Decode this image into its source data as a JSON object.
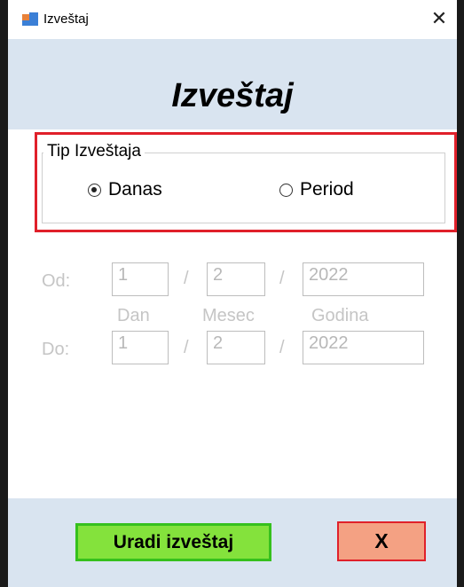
{
  "window": {
    "title": "Izveštaj",
    "close_label": "✕"
  },
  "header": {
    "title": "Izveštaj"
  },
  "report_type": {
    "legend": "Tip Izveštaja",
    "options": [
      {
        "label": "Danas",
        "selected": true
      },
      {
        "label": "Period",
        "selected": false
      }
    ]
  },
  "date_range": {
    "from_label": "Od:",
    "to_label": "Do:",
    "separator": "/",
    "column_labels": {
      "day": "Dan",
      "month": "Mesec",
      "year": "Godina"
    },
    "from": {
      "day": "1",
      "month": "2",
      "year": "2022"
    },
    "to": {
      "day": "1",
      "month": "2",
      "year": "2022"
    }
  },
  "footer": {
    "run_button": "Uradi izveštaj",
    "cancel_button": "X"
  }
}
